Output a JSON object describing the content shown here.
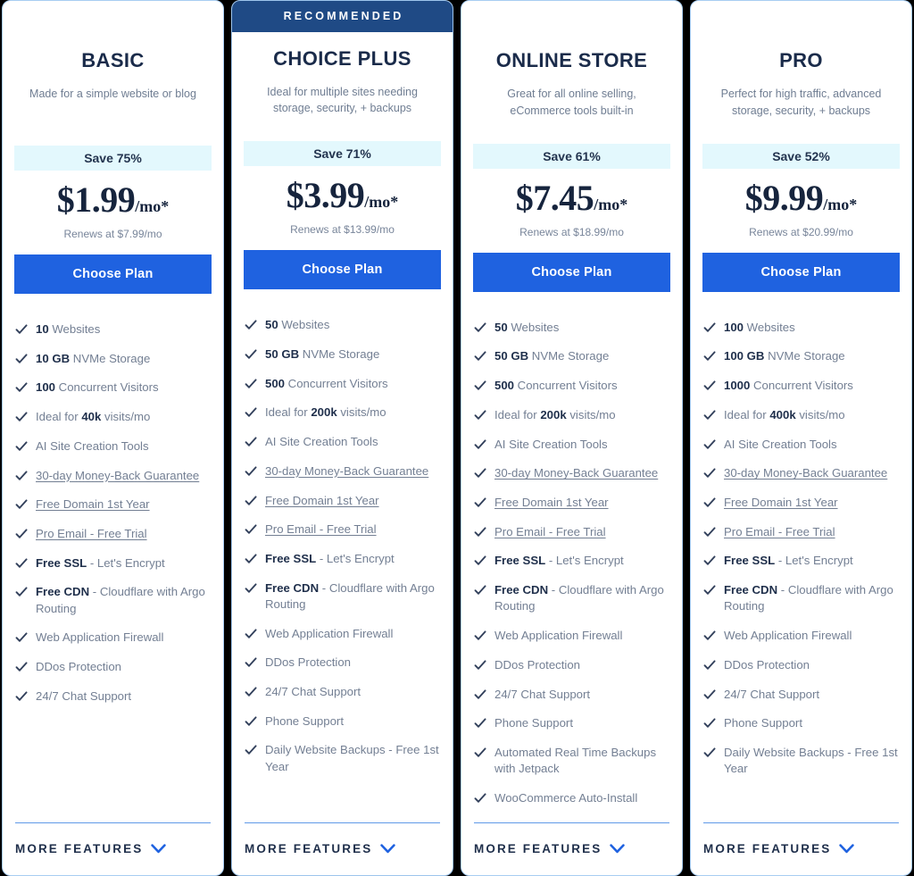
{
  "icons": {
    "check": "check-icon",
    "chevron_down": "chevron-down-icon"
  },
  "colors": {
    "cta_blue": "#1f62e0",
    "banner_navy": "#1f4a85",
    "save_badge_bg": "#e3f8fd",
    "card_border": "#a8cdf2",
    "divider_blue": "#5f9ae8",
    "heading_navy": "#1f2f4b",
    "body_gray": "#737f93"
  },
  "footer": {
    "more_features_label": "MORE FEATURES"
  },
  "plans": [
    {
      "id": "basic",
      "badge": null,
      "name": "BASIC",
      "tagline": "Made for a simple website or blog",
      "save_label": "Save 75%",
      "price": "$1.99",
      "price_suffix": "/mo*",
      "renews": "Renews at $7.99/mo",
      "cta_label": "Choose Plan",
      "features": [
        {
          "bold": "10",
          "text": " Websites",
          "link": false
        },
        {
          "bold": "10 GB",
          "text": " NVMe Storage",
          "link": false
        },
        {
          "bold": "100",
          "text": " Concurrent Visitors",
          "link": false
        },
        {
          "pre": "Ideal for ",
          "bold": "40k",
          "text": " visits/mo",
          "link": false
        },
        {
          "text": "AI Site Creation Tools",
          "link": false
        },
        {
          "text": "30-day Money-Back Guarantee",
          "link": true
        },
        {
          "text": "Free Domain 1st Year",
          "link": true
        },
        {
          "text": "Pro Email - Free Trial",
          "link": true
        },
        {
          "bold": "Free SSL",
          "text": " - Let's Encrypt",
          "link": false
        },
        {
          "bold": "Free CDN",
          "text": " - Cloudflare with Argo Routing",
          "link": false
        },
        {
          "text": "Web Application Firewall",
          "link": false
        },
        {
          "text": "DDos Protection",
          "link": false
        },
        {
          "text": "24/7 Chat Support",
          "link": false
        }
      ]
    },
    {
      "id": "choice-plus",
      "badge": "RECOMMENDED",
      "name": "CHOICE PLUS",
      "tagline": "Ideal for multiple sites needing storage, security, + backups",
      "save_label": "Save 71%",
      "price": "$3.99",
      "price_suffix": "/mo*",
      "renews": "Renews at $13.99/mo",
      "cta_label": "Choose Plan",
      "features": [
        {
          "bold": "50",
          "text": " Websites",
          "link": false
        },
        {
          "bold": "50 GB",
          "text": " NVMe Storage",
          "link": false
        },
        {
          "bold": "500",
          "text": " Concurrent Visitors",
          "link": false
        },
        {
          "pre": "Ideal for ",
          "bold": "200k",
          "text": " visits/mo",
          "link": false
        },
        {
          "text": "AI Site Creation Tools",
          "link": false
        },
        {
          "text": "30-day Money-Back Guarantee",
          "link": true
        },
        {
          "text": "Free Domain 1st Year",
          "link": true
        },
        {
          "text": "Pro Email - Free Trial",
          "link": true
        },
        {
          "bold": "Free SSL",
          "text": " - Let's Encrypt",
          "link": false
        },
        {
          "bold": "Free CDN",
          "text": " - Cloudflare with Argo Routing",
          "link": false
        },
        {
          "text": "Web Application Firewall",
          "link": false
        },
        {
          "text": "DDos Protection",
          "link": false
        },
        {
          "text": "24/7 Chat Support",
          "link": false
        },
        {
          "text": "Phone Support",
          "link": false
        },
        {
          "text": "Daily Website Backups - Free 1st Year",
          "link": false
        }
      ]
    },
    {
      "id": "online-store",
      "badge": null,
      "name": "ONLINE STORE",
      "tagline": "Great for all online selling, eCommerce tools built-in",
      "save_label": "Save 61%",
      "price": "$7.45",
      "price_suffix": "/mo*",
      "renews": "Renews at $18.99/mo",
      "cta_label": "Choose Plan",
      "features": [
        {
          "bold": "50",
          "text": " Websites",
          "link": false
        },
        {
          "bold": "50 GB",
          "text": " NVMe Storage",
          "link": false
        },
        {
          "bold": "500",
          "text": " Concurrent Visitors",
          "link": false
        },
        {
          "pre": "Ideal for ",
          "bold": "200k",
          "text": " visits/mo",
          "link": false
        },
        {
          "text": "AI Site Creation Tools",
          "link": false
        },
        {
          "text": "30-day Money-Back Guarantee",
          "link": true
        },
        {
          "text": "Free Domain 1st Year",
          "link": true
        },
        {
          "text": "Pro Email - Free Trial",
          "link": true
        },
        {
          "bold": "Free SSL",
          "text": " - Let's Encrypt",
          "link": false
        },
        {
          "bold": "Free CDN",
          "text": " - Cloudflare with Argo Routing",
          "link": false
        },
        {
          "text": "Web Application Firewall",
          "link": false
        },
        {
          "text": "DDos Protection",
          "link": false
        },
        {
          "text": "24/7 Chat Support",
          "link": false
        },
        {
          "text": "Phone Support",
          "link": false
        },
        {
          "text": "Automated Real Time Backups with Jetpack",
          "link": false
        },
        {
          "text": "WooCommerce Auto-Install",
          "link": false
        }
      ]
    },
    {
      "id": "pro",
      "badge": null,
      "name": "PRO",
      "tagline": "Perfect for high traffic, advanced storage, security, + backups",
      "save_label": "Save 52%",
      "price": "$9.99",
      "price_suffix": "/mo*",
      "renews": "Renews at $20.99/mo",
      "cta_label": "Choose Plan",
      "features": [
        {
          "bold": "100",
          "text": " Websites",
          "link": false
        },
        {
          "bold": "100 GB",
          "text": " NVMe Storage",
          "link": false
        },
        {
          "bold": "1000",
          "text": " Concurrent Visitors",
          "link": false
        },
        {
          "pre": "Ideal for ",
          "bold": "400k",
          "text": " visits/mo",
          "link": false
        },
        {
          "text": "AI Site Creation Tools",
          "link": false
        },
        {
          "text": "30-day Money-Back Guarantee",
          "link": true
        },
        {
          "text": "Free Domain 1st Year",
          "link": true
        },
        {
          "text": "Pro Email - Free Trial",
          "link": true
        },
        {
          "bold": "Free SSL",
          "text": " - Let's Encrypt",
          "link": false
        },
        {
          "bold": "Free CDN",
          "text": " - Cloudflare with Argo Routing",
          "link": false
        },
        {
          "text": "Web Application Firewall",
          "link": false
        },
        {
          "text": "DDos Protection",
          "link": false
        },
        {
          "text": "24/7 Chat Support",
          "link": false
        },
        {
          "text": "Phone Support",
          "link": false
        },
        {
          "text": "Daily Website Backups - Free 1st Year",
          "link": false
        }
      ]
    }
  ]
}
